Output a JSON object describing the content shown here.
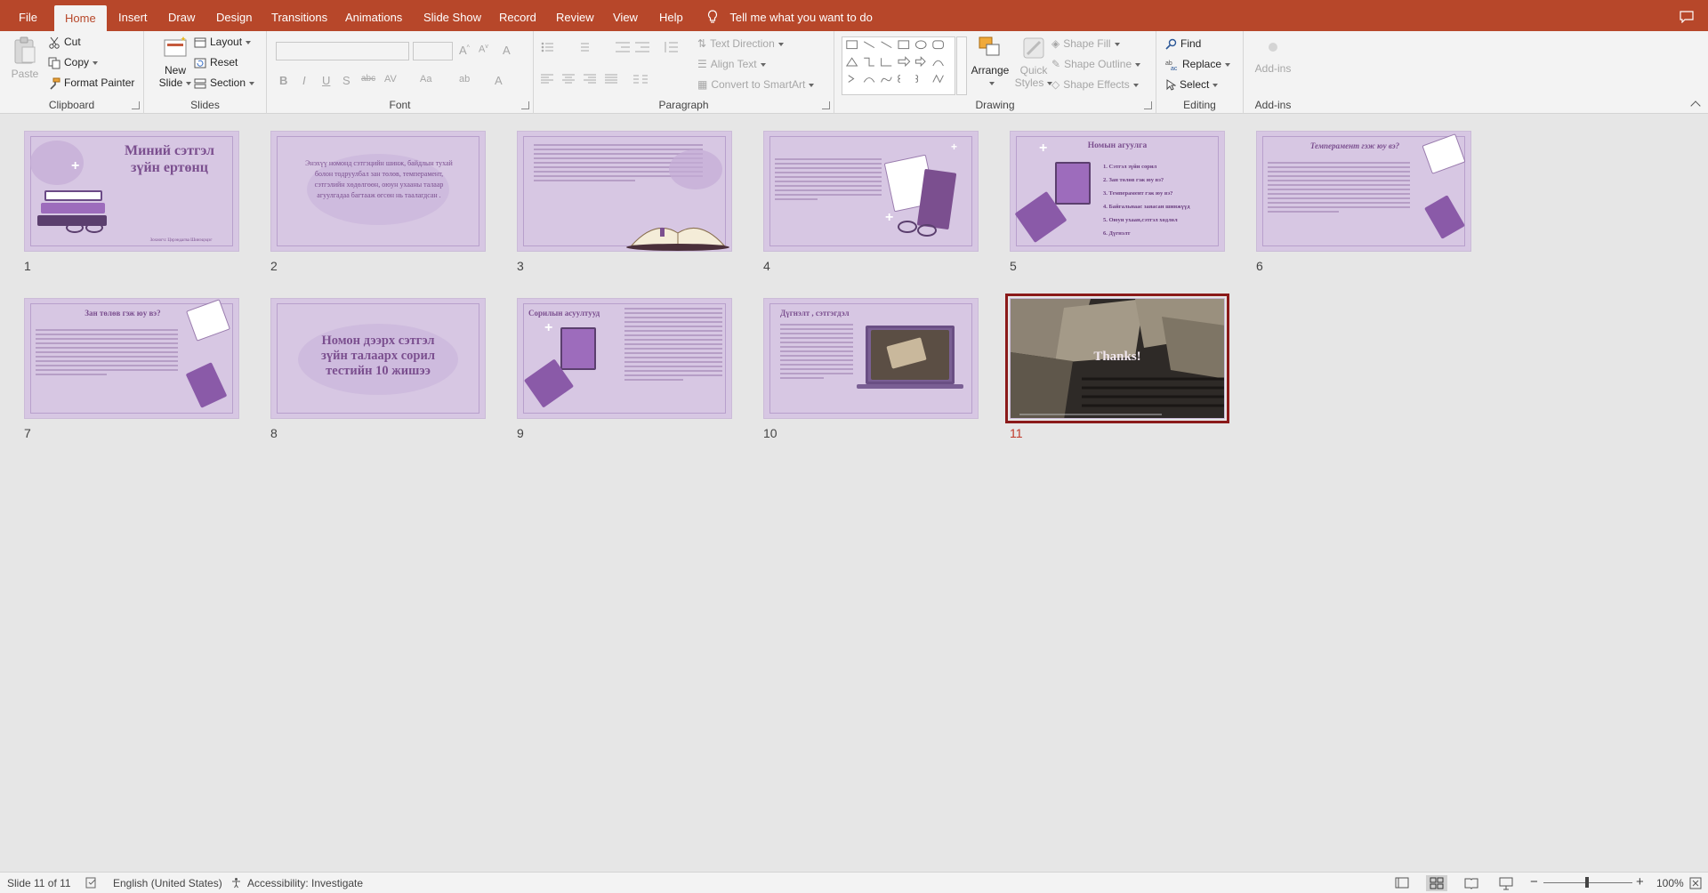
{
  "tabs": [
    "File",
    "Home",
    "Insert",
    "Draw",
    "Design",
    "Transitions",
    "Animations",
    "Slide Show",
    "Record",
    "Review",
    "View",
    "Help"
  ],
  "active_tab": "Home",
  "tell_me": "Tell me what you want to do",
  "ribbon": {
    "clipboard": {
      "label": "Clipboard",
      "paste": "Paste",
      "cut": "Cut",
      "copy": "Copy",
      "format_painter": "Format Painter"
    },
    "slides": {
      "label": "Slides",
      "new_slide_1": "New",
      "new_slide_2": "Slide",
      "layout": "Layout",
      "reset": "Reset",
      "section": "Section"
    },
    "font": {
      "label": "Font",
      "font_name": "",
      "font_size": ""
    },
    "paragraph": {
      "label": "Paragraph",
      "text_direction": "Text Direction",
      "align_text": "Align Text",
      "convert_smartart": "Convert to SmartArt"
    },
    "drawing": {
      "label": "Drawing",
      "arrange": "Arrange",
      "quick_styles_1": "Quick",
      "quick_styles_2": "Styles",
      "shape_fill": "Shape Fill",
      "shape_outline": "Shape Outline",
      "shape_effects": "Shape Effects"
    },
    "editing": {
      "label": "Editing",
      "find": "Find",
      "replace": "Replace",
      "select": "Select"
    },
    "addins": {
      "label": "Add-ins",
      "addins_btn": "Add-ins"
    }
  },
  "slides": [
    {
      "num": "1",
      "title_1": "Миний сэтгэл",
      "title_2": "зүйн ертөнц",
      "author": "Зохиогч: Цэрэндагва Шинэцэцэг"
    },
    {
      "num": "2",
      "text": "Энэхүү номонд сэтгэцийн шинж, байдлын тухай болон тодруулбал зан төлөв, темперамент, сэтгэлийн хөдөлгөөн, оюун ухааны талаар агуулгадаа багтааж өгсөн нь таалагдсан ."
    },
    {
      "num": "3"
    },
    {
      "num": "4"
    },
    {
      "num": "5",
      "title": "Номын агуулга",
      "items": [
        "1. Сэтгэл зүйн сорил",
        "2. Зан төлөв гэж юу вэ?",
        "3. Темперамент  гэж юу вэ?",
        "4. Байгальнаас заяасан шинжүүд",
        "5. Оюун ухаан,сэтгэл хөдлөл",
        "6. Дүгнэлт"
      ]
    },
    {
      "num": "6",
      "title": "Темперамент гэж юу вэ?"
    },
    {
      "num": "7",
      "title": "Зан төлөв гэж юу вэ?"
    },
    {
      "num": "8",
      "title_1": "Номон дээрх сэтгэл",
      "title_2": "зүйн талаарх сорил",
      "title_3": "тестийн 10 жишээ"
    },
    {
      "num": "9",
      "title": "Сорилын асуултууд"
    },
    {
      "num": "10",
      "title": "Дүгнэлт , сэтгэгдэл"
    },
    {
      "num": "11",
      "title": "Thanks!"
    }
  ],
  "status": {
    "slide_of": "Slide 11 of 11",
    "language": "English (United States)",
    "accessibility": "Accessibility: Investigate",
    "zoom": "100%"
  },
  "colors": {
    "accent": "#b7472a",
    "slide_bg": "#d7c7e3",
    "slide_title": "#7b4f8f",
    "selected_outline": "#8b1a1a"
  }
}
